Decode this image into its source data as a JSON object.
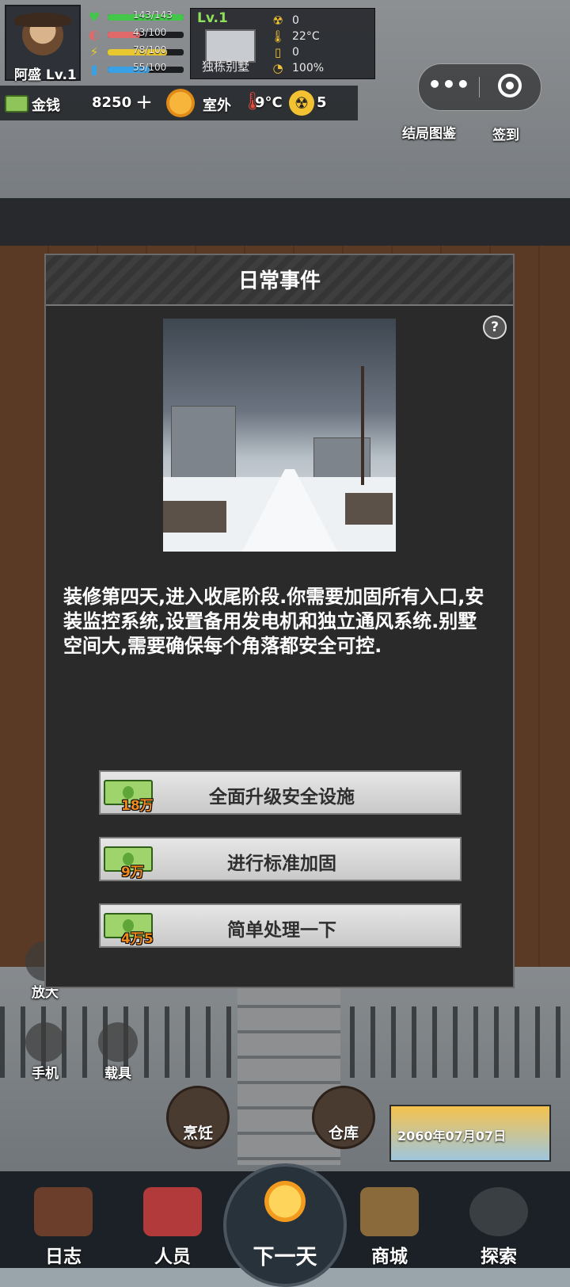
{
  "player": {
    "name": "阿盛 Lv.1"
  },
  "stats": [
    {
      "icon": "heart-icon",
      "glyph": "♥",
      "value": "143/143",
      "color": "#43c64a",
      "fill": 1.0
    },
    {
      "icon": "stomach-icon",
      "glyph": "◐",
      "value": "43/100",
      "color": "#e06a6a",
      "fill": 0.43
    },
    {
      "icon": "energy-icon",
      "glyph": "⚡",
      "value": "78/100",
      "color": "#e8c72f",
      "fill": 0.78
    },
    {
      "icon": "water-icon",
      "glyph": "▮",
      "value": "55/100",
      "color": "#3aa0e6",
      "fill": 0.55
    }
  ],
  "house": {
    "level": "Lv.1",
    "name": "独栋别墅",
    "env": [
      {
        "icon": "radiation-icon",
        "glyph": "☢",
        "value": "0"
      },
      {
        "icon": "thermometer-icon",
        "glyph": "🌡",
        "value": "22°C"
      },
      {
        "icon": "battery-icon",
        "glyph": "▯",
        "value": "0"
      },
      {
        "icon": "gauge-icon",
        "glyph": "◔",
        "value": "100%"
      }
    ]
  },
  "resources": {
    "money_label": "金钱",
    "money_value": "8250",
    "plus": "+",
    "outdoor_label": "室外",
    "outdoor_temp": "9°C",
    "radiation_value": "5"
  },
  "capsule": {
    "menu": "•••"
  },
  "top_links": {
    "ending_gallery": "结局图鉴",
    "check_in": "签到"
  },
  "modal": {
    "title": "日常事件",
    "help": "?",
    "text": "装修第四天,进入收尾阶段.你需要加固所有入口,安装监控系统,设置备用发电机和独立通风系统.别墅空间大,需要确保每个角落都安全可控.",
    "choices": [
      {
        "cost": "18万",
        "label": "全面升级安全设施"
      },
      {
        "cost": "9万",
        "label": "进行标准加固"
      },
      {
        "cost": "4万5",
        "label": "简单处理一下"
      }
    ]
  },
  "side_buttons": {
    "zoom": "放大",
    "phone": "手机",
    "vehicle": "载具"
  },
  "actions": {
    "cooking": "烹饪",
    "warehouse": "仓库"
  },
  "date": "2060年07月07日",
  "nav": {
    "log": "日志",
    "people": "人员",
    "next_day": "下一天",
    "shop": "商城",
    "explore": "探索"
  }
}
